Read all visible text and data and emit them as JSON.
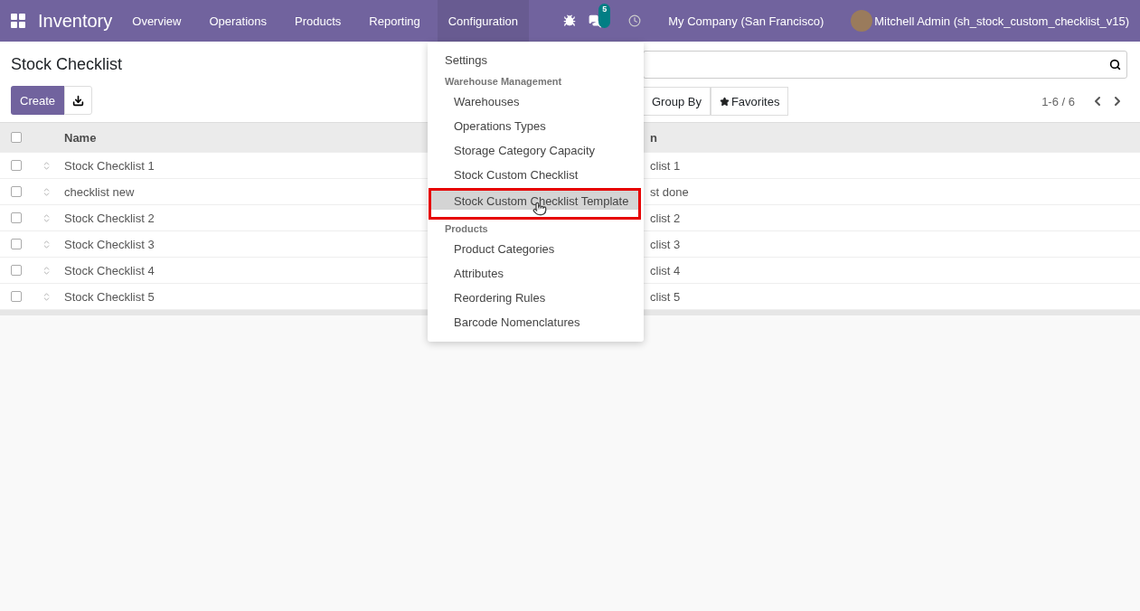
{
  "navbar": {
    "app": "Inventory",
    "menus": [
      {
        "label": "Overview",
        "open": false
      },
      {
        "label": "Operations",
        "open": false
      },
      {
        "label": "Products",
        "open": false
      },
      {
        "label": "Reporting",
        "open": false
      },
      {
        "label": "Configuration",
        "open": true
      }
    ],
    "messages_badge": "5",
    "company": "My Company (San Francisco)",
    "user": "Mitchell Admin (sh_stock_custom_checklist_v15)"
  },
  "control_panel": {
    "title": "Stock Checklist",
    "create": "Create",
    "filters": [
      "Group By",
      "Favorites"
    ],
    "pager": "1-6 / 6"
  },
  "table": {
    "select_all_checked": false,
    "columns": [
      "Name",
      "n"
    ],
    "rows": [
      {
        "name": "Stock Checklist 1",
        "column_2": "clist 1",
        "checked": false
      },
      {
        "name": "checklist new",
        "column_2": "st done",
        "checked": false
      },
      {
        "name": "Stock Checklist 2",
        "column_2": "clist 2",
        "checked": false
      },
      {
        "name": "Stock Checklist 3",
        "column_2": "clist 3",
        "checked": false
      },
      {
        "name": "Stock Checklist 4",
        "column_2": "clist 4",
        "checked": false
      },
      {
        "name": "Stock Checklist 5",
        "column_2": "clist 5",
        "checked": false
      }
    ]
  },
  "dropdown": {
    "items": [
      {
        "kind": "item",
        "label": "Settings",
        "selected": false
      },
      {
        "kind": "header",
        "label": "Warehouse Management"
      },
      {
        "kind": "subitem",
        "label": "Warehouses",
        "selected": false
      },
      {
        "kind": "subitem",
        "label": "Operations Types",
        "selected": false
      },
      {
        "kind": "subitem",
        "label": "Storage Category Capacity",
        "selected": false
      },
      {
        "kind": "subitem",
        "label": "Stock Custom Checklist",
        "selected": false
      },
      {
        "kind": "subitem",
        "label": "Stock Custom Checklist Template",
        "selected": true
      },
      {
        "kind": "header",
        "label": "Products"
      },
      {
        "kind": "subitem",
        "label": "Product Categories",
        "selected": false
      },
      {
        "kind": "subitem",
        "label": "Attributes",
        "selected": false
      },
      {
        "kind": "subitem",
        "label": "Reordering Rules",
        "selected": false
      },
      {
        "kind": "subitem",
        "label": "Barcode Nomenclatures",
        "selected": false
      }
    ]
  }
}
